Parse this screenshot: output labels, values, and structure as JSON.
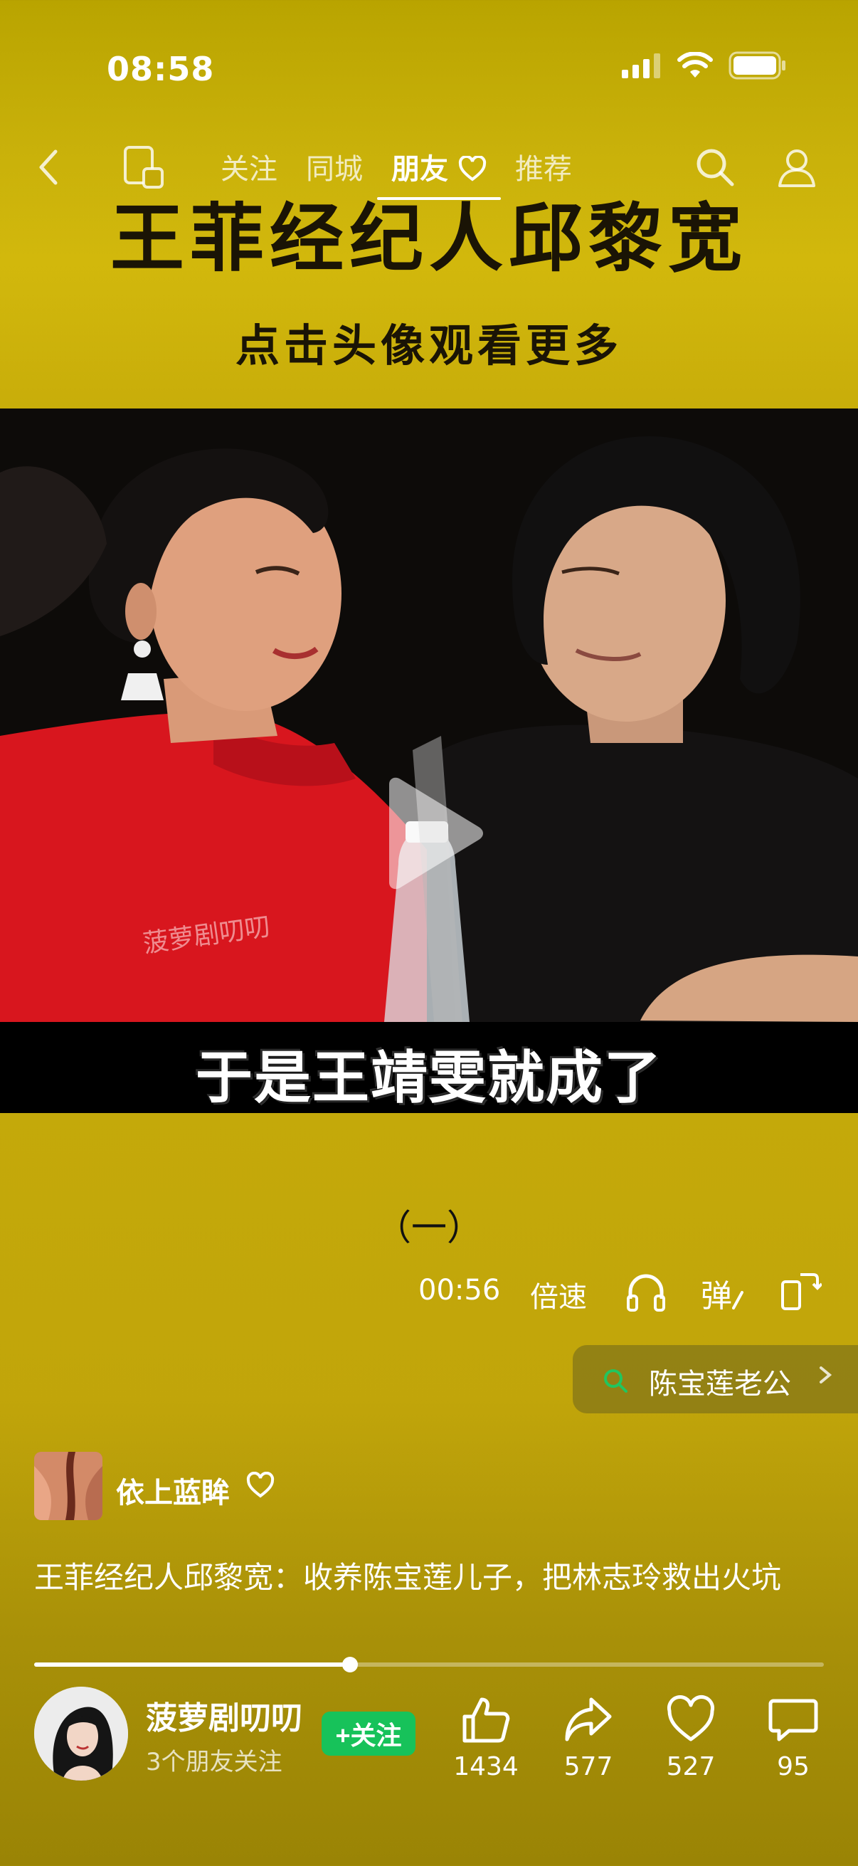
{
  "status_bar": {
    "time": "08:58"
  },
  "nav": {
    "tabs": [
      {
        "label": "关注"
      },
      {
        "label": "同城"
      },
      {
        "label": "朋友",
        "active": true
      },
      {
        "label": "推荐"
      }
    ]
  },
  "video": {
    "title": "王菲经纪人邱黎宽",
    "subtitle": "点击头像观看更多",
    "watermark": "菠萝剧叨叨",
    "caption": "于是王靖雯就成了",
    "part": "（一）",
    "time": "00:56",
    "speed_label": "倍速",
    "danmu_label": "弹",
    "progress": 0.4
  },
  "search_suggestion": {
    "text": "陈宝莲老公"
  },
  "author": {
    "name": "依上蓝眸"
  },
  "description": "王菲经纪人邱黎宽：收养陈宝莲儿子，把林志玲救出火坑",
  "poster": {
    "name": "菠萝剧叨叨",
    "friends": "3个朋友关注",
    "follow_label": "+关注"
  },
  "actions": {
    "likes": "1434",
    "shares": "577",
    "favorites": "527",
    "comments": "95"
  }
}
